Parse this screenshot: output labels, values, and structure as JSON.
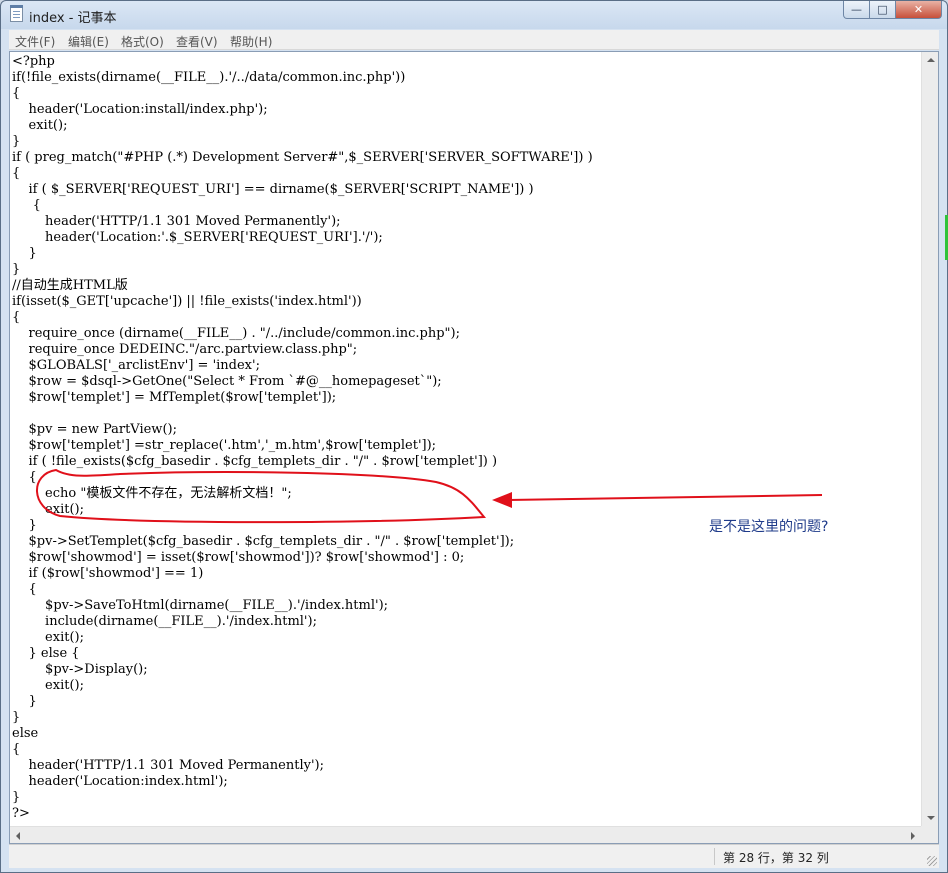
{
  "window": {
    "title": "index - 记事本",
    "buttons": {
      "minimize": "—",
      "maximize": "□",
      "close": "✕"
    }
  },
  "menu": {
    "items": [
      "文件(F)",
      "编辑(E)",
      "格式(O)",
      "查看(V)",
      "帮助(H)"
    ]
  },
  "editor": {
    "lines": [
      "<?php",
      "if(!file_exists(dirname(__FILE__).'/../data/common.inc.php'))",
      "{",
      "    header('Location:install/index.php');",
      "    exit();",
      "}",
      "if ( preg_match(\"#PHP (.*) Development Server#\",$_SERVER['SERVER_SOFTWARE']) )",
      "{",
      "    if ( $_SERVER['REQUEST_URI'] == dirname($_SERVER['SCRIPT_NAME']) )",
      "     {",
      "        header('HTTP/1.1 301 Moved Permanently');",
      "        header('Location:'.$_SERVER['REQUEST_URI'].'/');",
      "    }",
      "}",
      "//自动生成HTML版",
      "if(isset($_GET['upcache']) || !file_exists('index.html'))",
      "{",
      "    require_once (dirname(__FILE__) . \"/../include/common.inc.php\");",
      "    require_once DEDEINC.\"/arc.partview.class.php\";",
      "    $GLOBALS['_arclistEnv'] = 'index';",
      "    $row = $dsql->GetOne(\"Select * From `#@__homepageset`\");",
      "    $row['templet'] = MfTemplet($row['templet']);",
      "",
      "    $pv = new PartView();",
      "    $row['templet'] =str_replace('.htm','_m.htm',$row['templet']);",
      "    if ( !file_exists($cfg_basedir . $cfg_templets_dir . \"/\" . $row['templet']) )",
      "    {",
      "        echo \"模板文件不存在，无法解析文档！\";",
      "        exit();",
      "    }",
      "    $pv->SetTemplet($cfg_basedir . $cfg_templets_dir . \"/\" . $row['templet']);",
      "    $row['showmod'] = isset($row['showmod'])? $row['showmod'] : 0;",
      "    if ($row['showmod'] == 1)",
      "    {",
      "        $pv->SaveToHtml(dirname(__FILE__).'/index.html');",
      "        include(dirname(__FILE__).'/index.html');",
      "        exit();",
      "    } else {",
      "        $pv->Display();",
      "        exit();",
      "    }",
      "}",
      "else",
      "{",
      "    header('HTTP/1.1 301 Moved Permanently');",
      "    header('Location:index.html');",
      "}",
      "?>"
    ]
  },
  "status": {
    "position": "第 28 行，第 32 列"
  },
  "annotation": {
    "text": "是不是这里的问题?",
    "color": "#e0101a"
  }
}
